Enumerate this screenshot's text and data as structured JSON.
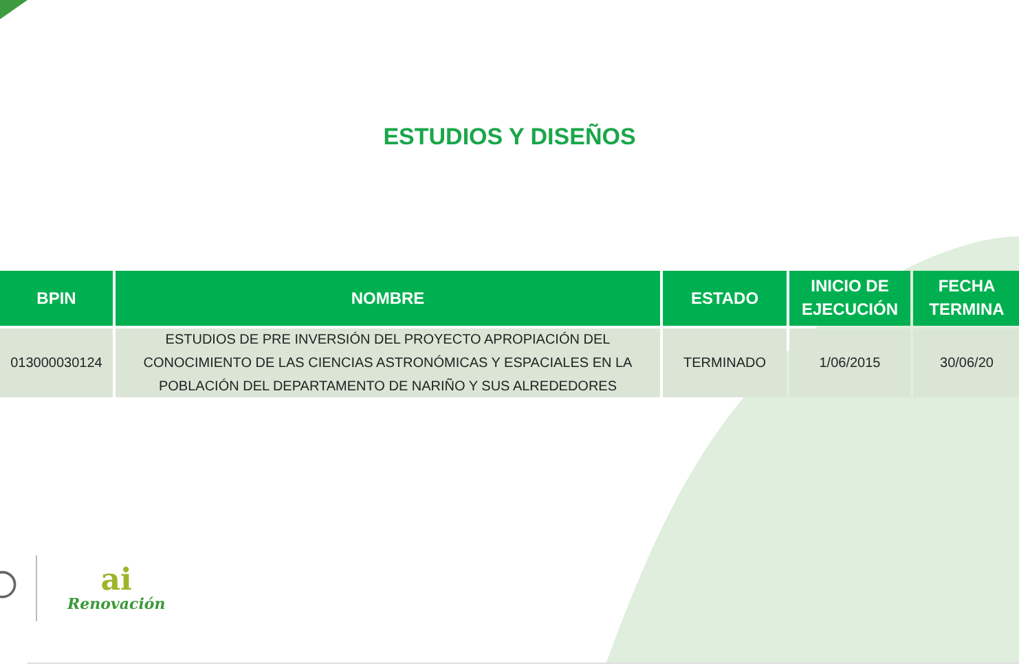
{
  "title": "ESTUDIOS Y DISEÑOS",
  "table": {
    "columns": [
      "BPIN",
      "NOMBRE",
      "ESTADO",
      "INICIO DE EJECUCIÓN",
      "FECHA TERMINA"
    ],
    "rows": [
      [
        "013000030124",
        "ESTUDIOS DE PRE INVERSIÓN DEL PROYECTO APROPIACIÓN DEL CONOCIMIENTO DE LAS CIENCIAS ASTRONÓMICAS Y ESPACIALES EN LA POBLACIÓN DEL DEPARTAMENTO DE NARIÑO Y SUS ALREDEDORES",
        "TERMINADO",
        "1/06/2015",
        "30/06/20"
      ]
    ]
  },
  "logo": {
    "mark": "ai",
    "name": "Renovación"
  }
}
